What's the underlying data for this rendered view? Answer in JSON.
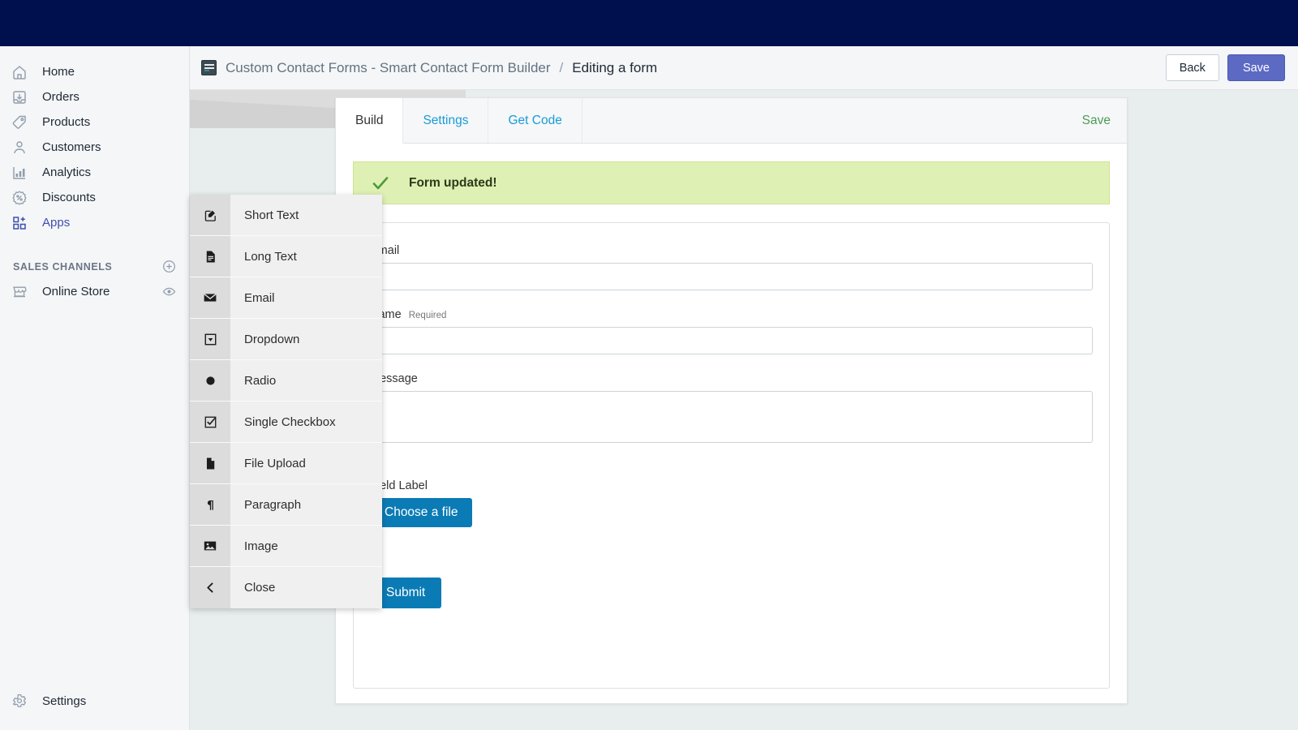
{
  "topbar": {
    "color": "#000f4d"
  },
  "sidebar": {
    "items": [
      {
        "label": "Home",
        "icon": "home-icon",
        "active": false
      },
      {
        "label": "Orders",
        "icon": "orders-icon",
        "active": false
      },
      {
        "label": "Products",
        "icon": "products-tag-icon",
        "active": false
      },
      {
        "label": "Customers",
        "icon": "customers-person-icon",
        "active": false
      },
      {
        "label": "Analytics",
        "icon": "analytics-bar-chart-icon",
        "active": false
      },
      {
        "label": "Discounts",
        "icon": "discounts-percent-icon",
        "active": false
      },
      {
        "label": "Apps",
        "icon": "apps-grid-plus-icon",
        "active": true
      }
    ],
    "section_title": "SALES CHANNELS",
    "add_channel_icon": "plus-circle-icon",
    "channels": [
      {
        "label": "Online Store",
        "icon": "storefront-icon",
        "trailing_icon": "eye-icon"
      }
    ],
    "settings": {
      "label": "Settings",
      "icon": "gear-icon"
    }
  },
  "header": {
    "app_icon": "app-tile-icon",
    "breadcrumb_app": "Custom Contact Forms - Smart Contact Form Builder",
    "breadcrumb_separator": "/",
    "breadcrumb_current": "Editing a form",
    "back_label": "Back",
    "save_label": "Save",
    "save_color": "#5c6ac4"
  },
  "card": {
    "tabs": [
      {
        "label": "Build",
        "active": true
      },
      {
        "label": "Settings",
        "active": false
      },
      {
        "label": "Get Code",
        "active": false
      }
    ],
    "tab_save_label": "Save",
    "tab_save_color": "#4f9b56",
    "alert": {
      "icon": "check-icon",
      "message": "Form updated!",
      "background": "#dff0b4",
      "icon_color": "#4e9a3a"
    },
    "form_fields": [
      {
        "label": "Email",
        "required_note": "",
        "type": "text"
      },
      {
        "label": "Name",
        "required_note": "Required",
        "type": "text"
      },
      {
        "label": "Message",
        "required_note": "",
        "type": "textarea"
      },
      {
        "label": "Field Label",
        "required_note": "",
        "type": "file",
        "button_label": "Choose a file"
      }
    ],
    "submit_label": "Submit",
    "button_color": "#0b7bb5"
  },
  "field_menu": {
    "items": [
      {
        "label": "Short Text",
        "icon": "pencil-square-icon"
      },
      {
        "label": "Long Text",
        "icon": "document-lines-icon"
      },
      {
        "label": "Email",
        "icon": "envelope-icon"
      },
      {
        "label": "Dropdown",
        "icon": "caret-down-box-icon"
      },
      {
        "label": "Radio",
        "icon": "radio-dot-icon"
      },
      {
        "label": "Single Checkbox",
        "icon": "checkbox-checked-icon"
      },
      {
        "label": "File Upload",
        "icon": "file-page-icon"
      },
      {
        "label": "Paragraph",
        "icon": "pilcrow-icon"
      },
      {
        "label": "Image",
        "icon": "image-picture-icon"
      },
      {
        "label": "Close",
        "icon": "chevron-left-icon"
      }
    ]
  }
}
